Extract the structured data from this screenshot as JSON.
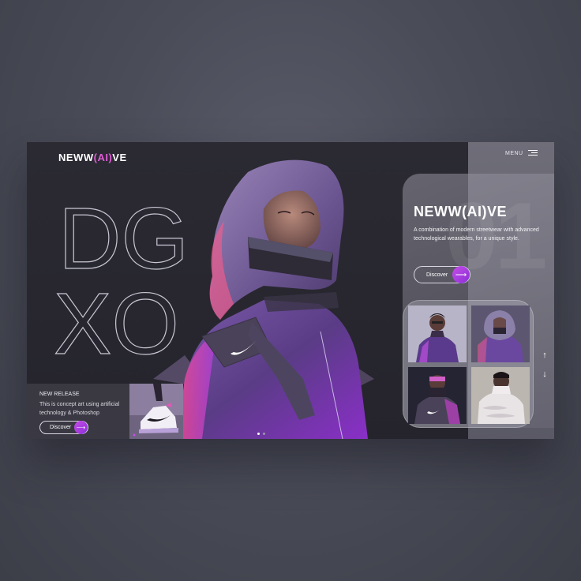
{
  "brand": {
    "logo_prefix": "NEWW",
    "logo_mid": "(AI)",
    "logo_suffix": "VE"
  },
  "menu": {
    "label": "MENU",
    "icon": "hamburger-icon"
  },
  "hero": {
    "outline_line1": "DG",
    "outline_line2": "XO"
  },
  "release": {
    "title": "NEW RELEASE",
    "text": "This is concept art using artificial technology & Photoshop",
    "button_label": "Discover"
  },
  "card": {
    "number": "01",
    "logo_prefix": "NEWW",
    "logo_mid": "(AI)",
    "logo_suffix": "VE",
    "description": "A combination of modern streetwear with advanced technological wearables, for a unique style.",
    "button_label": "Discover"
  },
  "gallery": {
    "up_arrow": "↑",
    "down_arrow": "↓"
  },
  "colors": {
    "accent": "#c64de8",
    "accent_dark": "#8a2fd6",
    "frame_bg": "#2b2a33",
    "strip_bg": "#6e6d78"
  }
}
